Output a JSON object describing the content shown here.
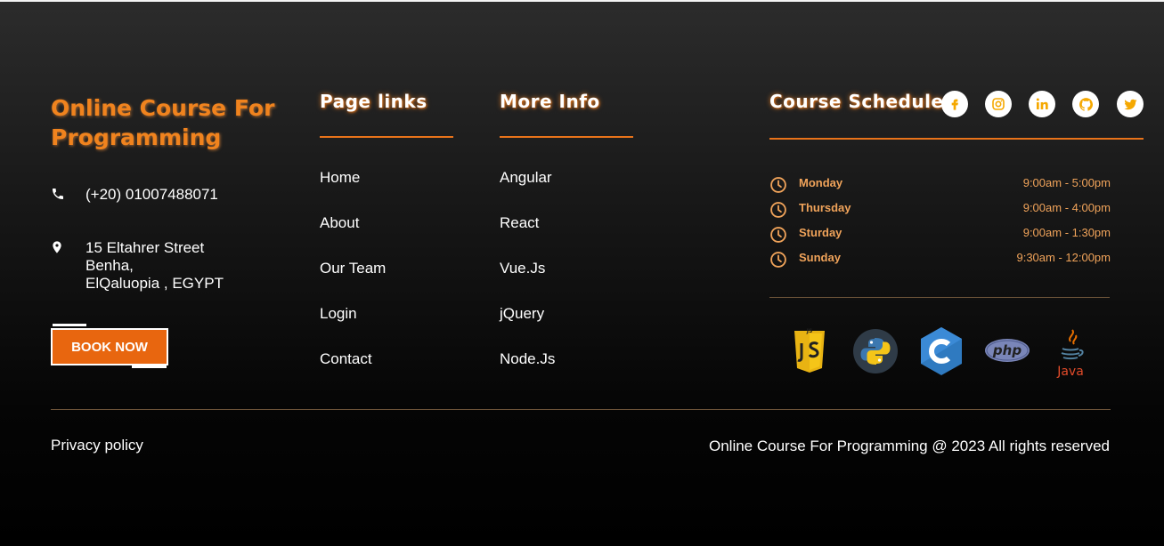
{
  "brand": {
    "name": "Online Course For Programming"
  },
  "contact": {
    "phone": "(+20) 01007488071",
    "address_line1": "15 Eltahrer Street",
    "address_line2": "Benha,",
    "address_line3": "ElQaluopia , EGYPT",
    "book_label": "BOOK NOW"
  },
  "page_links": {
    "title": "Page links",
    "items": [
      "Home",
      "About",
      "Our Team",
      "Login",
      "Contact"
    ]
  },
  "more_info": {
    "title": "More Info",
    "items": [
      "Angular",
      "React",
      "Vue.Js",
      "jQuery",
      "Node.Js"
    ]
  },
  "schedule": {
    "title": "Course Schedule",
    "rows": [
      {
        "day": "Monday",
        "time": "9:00am - 5:00pm"
      },
      {
        "day": "Thursday",
        "time": "9:00am - 4:00pm"
      },
      {
        "day": "Sturday",
        "time": "9:00am - 1:30pm"
      },
      {
        "day": "Sunday",
        "time": "9:30am - 12:00pm"
      }
    ]
  },
  "social_icons": [
    "facebook-icon",
    "instagram-icon",
    "linkedin-icon",
    "github-icon",
    "twitter-icon"
  ],
  "tech_logos": {
    "js": "JS",
    "php": "php",
    "java": "Java"
  },
  "footer": {
    "privacy": "Privacy policy",
    "copyright": "Online Course For Programming @ 2023 All rights reserved"
  },
  "colors": {
    "accent": "#e8731a",
    "brand_text": "#f0831e",
    "schedule_text": "#f0a35a",
    "social_icon": "#f5a800"
  }
}
